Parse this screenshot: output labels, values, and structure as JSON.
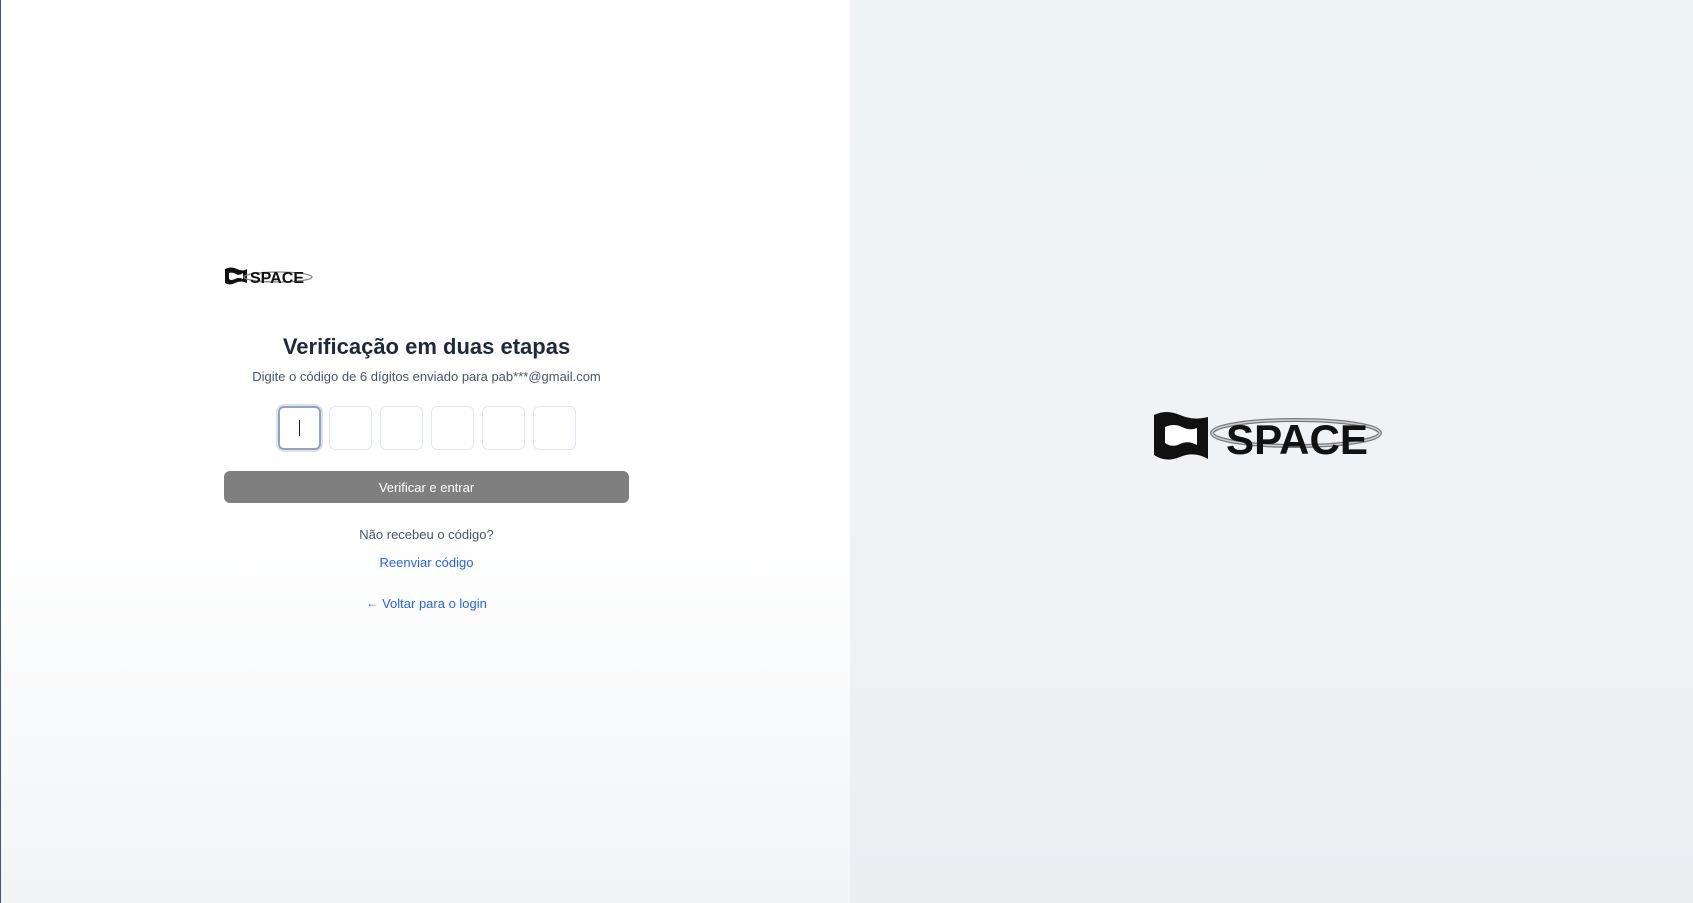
{
  "brand": {
    "name": "SPACE"
  },
  "verification": {
    "title": "Verificação em duas etapas",
    "subtitle": "Digite o código de 6 dígitos enviado para pab***@gmail.com",
    "code_digits": [
      "",
      "",
      "",
      "",
      "",
      ""
    ],
    "submit_label": "Verificar e entrar",
    "no_code_text": "Não recebeu o código?",
    "resend_label": "Reenviar código",
    "back_label": "Voltar para o login",
    "back_icon": "arrow-left-icon"
  },
  "colors": {
    "title": "#1e293b",
    "link": "#2563eb",
    "button_disabled": "#7f7f7f",
    "right_panel": "#eef3f5"
  }
}
